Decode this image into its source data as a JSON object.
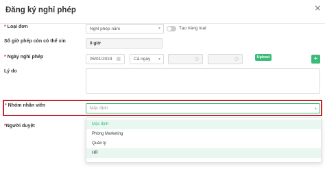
{
  "dialog": {
    "title": "Đăng ký nghỉ phép",
    "close_glyph": "×"
  },
  "fields": {
    "leave_type": {
      "label": "Loại đơn",
      "value": "Nghỉ phép năm",
      "toggle_label": "Tạo hàng loạt"
    },
    "remaining": {
      "label": "Số giờ phép còn có thể xin",
      "value": "0 giờ"
    },
    "leave_date": {
      "label": "Ngày nghỉ phép",
      "date": "05/01/2024",
      "period": "Cả ngày",
      "upload_label": "Upload",
      "add_label": "+"
    },
    "reason": {
      "label": "Lý do"
    },
    "employee_group": {
      "label": "Nhóm nhân viên",
      "placeholder": "Mặc định"
    },
    "approver": {
      "label": "Người duyệt"
    }
  },
  "dropdown": {
    "options": [
      "Mặc định",
      "Phòng Marketing",
      "Quản lý",
      "HR"
    ]
  },
  "colors": {
    "accent": "#3cba7a",
    "highlight": "#c0282d",
    "required": "#e02424"
  }
}
